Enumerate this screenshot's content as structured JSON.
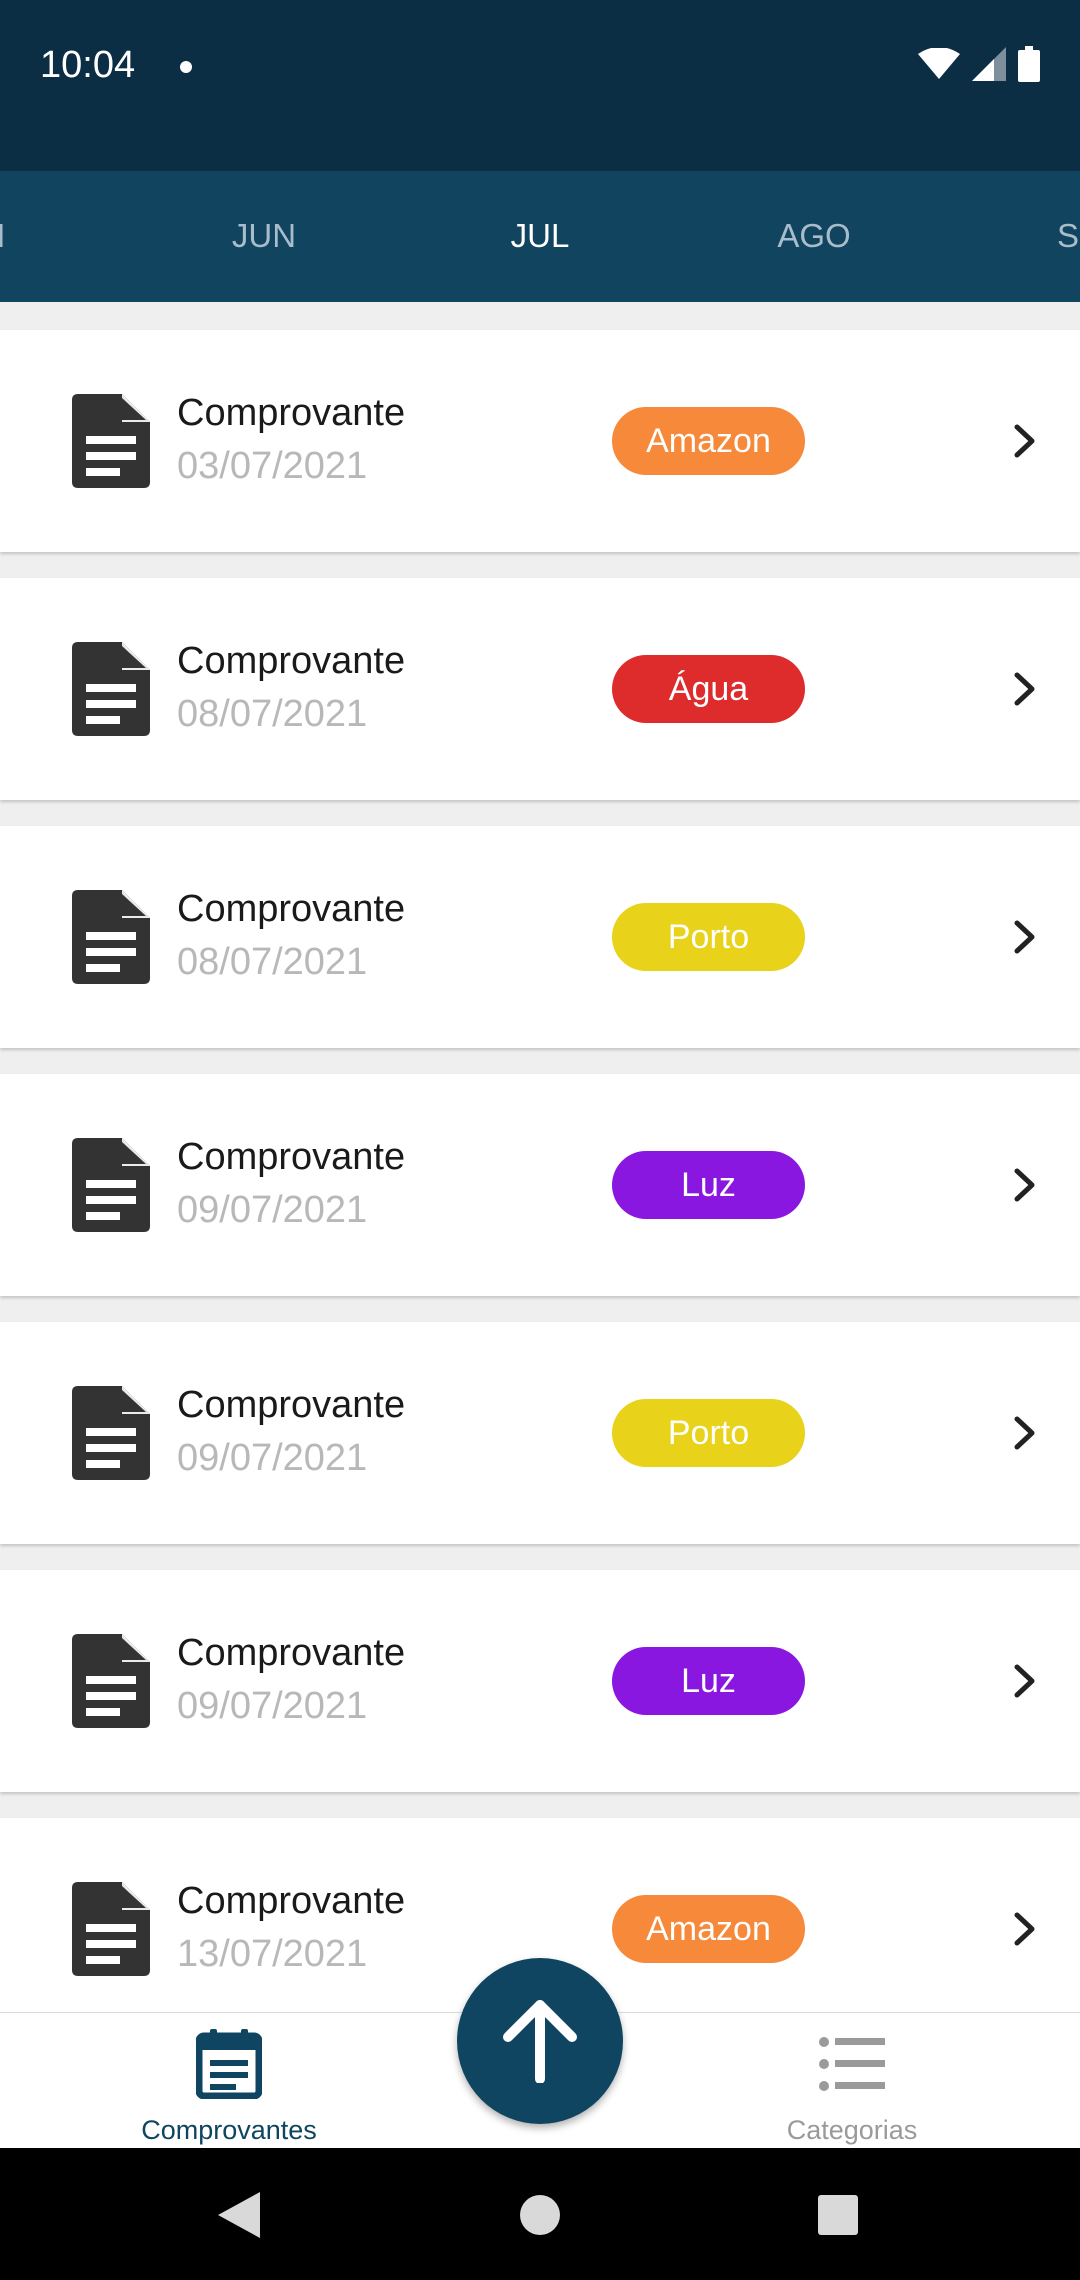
{
  "status_bar": {
    "time": "10:04"
  },
  "months": [
    {
      "label": "AI",
      "active": false
    },
    {
      "label": "JUN",
      "active": false
    },
    {
      "label": "JUL",
      "active": true
    },
    {
      "label": "AGO",
      "active": false
    },
    {
      "label": "S",
      "active": false
    }
  ],
  "receipts": [
    {
      "title": "Comprovante",
      "date": "03/07/2021",
      "category": "Amazon",
      "color": "#f7893b"
    },
    {
      "title": "Comprovante",
      "date": "08/07/2021",
      "category": "Água",
      "color": "#de2b2b"
    },
    {
      "title": "Comprovante",
      "date": "08/07/2021",
      "category": "Porto",
      "color": "#e8d21a"
    },
    {
      "title": "Comprovante",
      "date": "09/07/2021",
      "category": "Luz",
      "color": "#8a17e0"
    },
    {
      "title": "Comprovante",
      "date": "09/07/2021",
      "category": "Porto",
      "color": "#e8d21a"
    },
    {
      "title": "Comprovante",
      "date": "09/07/2021",
      "category": "Luz",
      "color": "#8a17e0"
    },
    {
      "title": "Comprovante",
      "date": "13/07/2021",
      "category": "Amazon",
      "color": "#f7893b"
    }
  ],
  "bottom_nav": {
    "comprovantes": {
      "label": "Comprovantes",
      "color": "#0f4560"
    },
    "categorias": {
      "label": "Categorias",
      "color": "#9a9a9a"
    }
  },
  "fab": {
    "icon": "arrow-up-icon"
  }
}
